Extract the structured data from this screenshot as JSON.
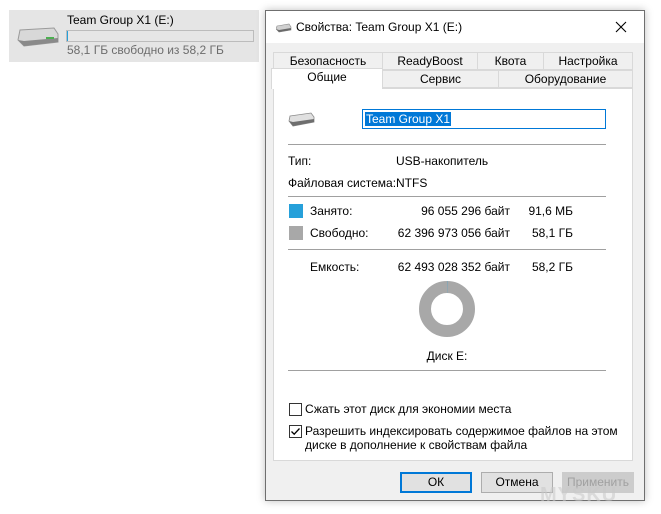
{
  "explorer": {
    "drive_name": "Team Group X1 (E:)",
    "free_text": "58,1 ГБ свободно из 58,2 ГБ",
    "used_fraction": 0.0015
  },
  "dialog": {
    "title": "Свойства: Team Group X1 (E:)",
    "tabs_row1": [
      "Безопасность",
      "ReadyBoost",
      "Квота",
      "Настройка"
    ],
    "tabs_row2": [
      "Общие",
      "Сервис",
      "Оборудование"
    ],
    "active_tab": "Общие",
    "name_value": "Team Group X1",
    "type_label": "Тип:",
    "type_value": "USB-накопитель",
    "fs_label": "Файловая система:",
    "fs_value": "NTFS",
    "used_label": "Занято:",
    "used_bytes": "96 055 296 байт",
    "used_size": "91,6 МБ",
    "free_label": "Свободно:",
    "free_bytes": "62 396 973 056 байт",
    "free_size": "58,1 ГБ",
    "capacity_label": "Емкость:",
    "capacity_bytes": "62 493 028 352 байт",
    "capacity_size": "58,2 ГБ",
    "disk_label": "Диск E:",
    "compress_label": "Сжать этот диск для экономии места",
    "compress_checked": false,
    "index_label_line1": "Разрешить индексировать содержимое файлов на этом",
    "index_label_line2": "диске в дополнение к свойствам файла",
    "index_checked": true,
    "ok_label": "ОК",
    "cancel_label": "Отмена",
    "apply_label": "Применить"
  },
  "colors": {
    "used": "#26a0da",
    "free": "#a8a8a8",
    "accent": "#0078d7"
  },
  "watermark": "MYSKU"
}
